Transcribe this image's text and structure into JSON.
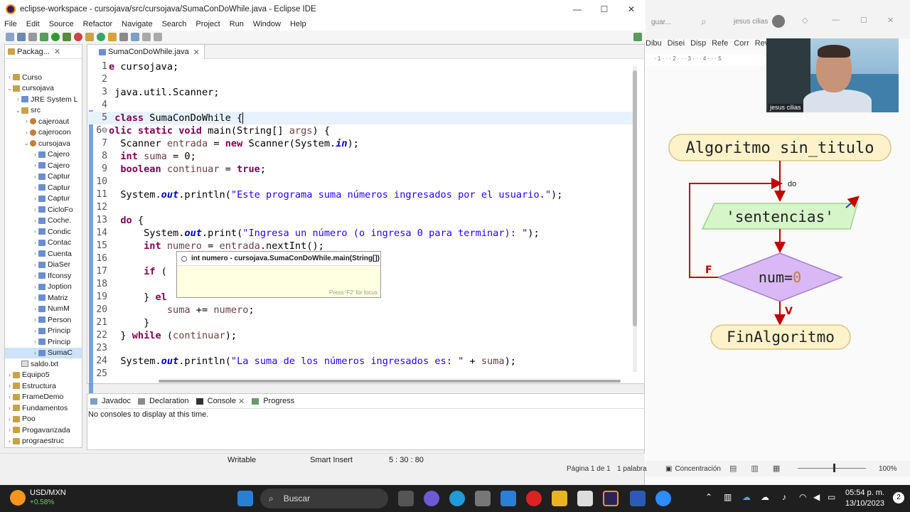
{
  "window": {
    "title": "eclipse-workspace - cursojava/src/cursojava/SumaConDoWhile.java - Eclipse IDE",
    "controls": [
      "—",
      "☐",
      "✕"
    ]
  },
  "menu": [
    "File",
    "Edit",
    "Source",
    "Refactor",
    "Navigate",
    "Search",
    "Project",
    "Run",
    "Window",
    "Help"
  ],
  "package_explorer": {
    "tab_label": "Packag...",
    "items": [
      {
        "label": "Curso",
        "indent": 0,
        "arrow": "›",
        "icon": "proj"
      },
      {
        "label": "cursojava",
        "indent": 0,
        "arrow": "⌄",
        "icon": "proj"
      },
      {
        "label": "JRE System L",
        "indent": 1,
        "arrow": "›",
        "icon": "jicon"
      },
      {
        "label": "src",
        "indent": 1,
        "arrow": "⌄",
        "icon": "proj"
      },
      {
        "label": "cajeroaut",
        "indent": 2,
        "arrow": "›",
        "icon": "pkgicon"
      },
      {
        "label": "cajerocon",
        "indent": 2,
        "arrow": "›",
        "icon": "pkgicon"
      },
      {
        "label": "cursojava",
        "indent": 2,
        "arrow": "⌄",
        "icon": "pkgicon"
      },
      {
        "label": "Cajero",
        "indent": 3,
        "arrow": "›",
        "icon": "jicon"
      },
      {
        "label": "Cajero",
        "indent": 3,
        "arrow": "›",
        "icon": "jicon"
      },
      {
        "label": "Captur",
        "indent": 3,
        "arrow": "›",
        "icon": "jicon"
      },
      {
        "label": "Captur",
        "indent": 3,
        "arrow": "›",
        "icon": "jicon"
      },
      {
        "label": "Captur",
        "indent": 3,
        "arrow": "›",
        "icon": "jicon"
      },
      {
        "label": "CicloFo",
        "indent": 3,
        "arrow": "›",
        "icon": "jicon"
      },
      {
        "label": "Coche.",
        "indent": 3,
        "arrow": "›",
        "icon": "jicon"
      },
      {
        "label": "Condic",
        "indent": 3,
        "arrow": "›",
        "icon": "jicon"
      },
      {
        "label": "Contac",
        "indent": 3,
        "arrow": "›",
        "icon": "jicon"
      },
      {
        "label": "Cuenta",
        "indent": 3,
        "arrow": "›",
        "icon": "jicon"
      },
      {
        "label": "DiaSer",
        "indent": 3,
        "arrow": "›",
        "icon": "jicon"
      },
      {
        "label": "Ifconsy",
        "indent": 3,
        "arrow": "›",
        "icon": "jicon"
      },
      {
        "label": "Joption",
        "indent": 3,
        "arrow": "›",
        "icon": "jicon"
      },
      {
        "label": "Matriz",
        "indent": 3,
        "arrow": "›",
        "icon": "jicon"
      },
      {
        "label": "NumM",
        "indent": 3,
        "arrow": "›",
        "icon": "jicon"
      },
      {
        "label": "Person",
        "indent": 3,
        "arrow": "›",
        "icon": "jicon"
      },
      {
        "label": "Princip",
        "indent": 3,
        "arrow": "›",
        "icon": "jicon"
      },
      {
        "label": "Princip",
        "indent": 3,
        "arrow": "›",
        "icon": "jicon"
      },
      {
        "label": "SumaC",
        "indent": 3,
        "arrow": "›",
        "icon": "jicon",
        "selected": true
      },
      {
        "label": "saldo.txt",
        "indent": 1,
        "arrow": "",
        "icon": "txticon"
      },
      {
        "label": "Equipo5",
        "indent": 0,
        "arrow": "›",
        "icon": "proj"
      },
      {
        "label": "Estructura",
        "indent": 0,
        "arrow": "›",
        "icon": "proj"
      },
      {
        "label": "FrameDemo",
        "indent": 0,
        "arrow": "›",
        "icon": "proj"
      },
      {
        "label": "Fundamentos",
        "indent": 0,
        "arrow": "›",
        "icon": "proj"
      },
      {
        "label": "Poo",
        "indent": 0,
        "arrow": "›",
        "icon": "proj"
      },
      {
        "label": "Progavanzada",
        "indent": 0,
        "arrow": "›",
        "icon": "proj"
      },
      {
        "label": "prograestruc",
        "indent": 0,
        "arrow": "›",
        "icon": "proj"
      }
    ]
  },
  "editor": {
    "tab": "SumaConDoWhile.java",
    "lines": [
      {
        "n": "1",
        "html": "<span class=\"kw\">e</span> cursojava;"
      },
      {
        "n": "2",
        "html": ""
      },
      {
        "n": "3",
        "html": " java.util.Scanner;"
      },
      {
        "n": "4",
        "html": ""
      },
      {
        "n": "5",
        "html": " <span class=\"kw\">class</span> SumaConDoWhile {",
        "current": true
      },
      {
        "n": "6⊖",
        "html": "<span class=\"kw\">olic static void</span> main(String[] <span class=\"var\">args</span>) {"
      },
      {
        "n": "7",
        "html": "  Scanner <span class=\"var\">entrada</span> = <span class=\"kw\">new</span> Scanner(System.<span class=\"fld\">in</span>);"
      },
      {
        "n": "8",
        "html": "  <span class=\"kw\">int</span> <span class=\"var\">suma</span> = 0;"
      },
      {
        "n": "9",
        "html": "  <span class=\"kw\">boolean</span> <span class=\"var\">continuar</span> = <span class=\"kw\">true</span>;"
      },
      {
        "n": "10",
        "html": ""
      },
      {
        "n": "11",
        "html": "  System.<span class=\"fld\">out</span>.println(<span class=\"str\">\"Este programa suma números ingresados por el usuario.\"</span>);"
      },
      {
        "n": "12",
        "html": ""
      },
      {
        "n": "13",
        "html": "  <span class=\"kw\">do</span> {"
      },
      {
        "n": "14",
        "html": "      System.<span class=\"fld\">out</span>.print(<span class=\"str\">\"Ingresa un número (o ingresa 0 para terminar): \"</span>);"
      },
      {
        "n": "15",
        "html": "      <span class=\"kw\">int</span> <span class=\"var\">numero</span> = <span class=\"var\">entrada</span>.nextInt();"
      },
      {
        "n": "16",
        "html": ""
      },
      {
        "n": "17",
        "html": "      <span class=\"kw\">if</span> ("
      },
      {
        "n": "18",
        "html": ""
      },
      {
        "n": "19",
        "html": "      } <span class=\"kw\">el</span>"
      },
      {
        "n": "20",
        "html": "          <span class=\"var\">suma</span> += <span class=\"var\">numero</span>;"
      },
      {
        "n": "21",
        "html": "      }"
      },
      {
        "n": "22",
        "html": "  } <span class=\"kw\">while</span> (<span class=\"var\">continuar</span>);"
      },
      {
        "n": "23",
        "html": ""
      },
      {
        "n": "24",
        "html": "  System.<span class=\"fld\">out</span>.println(<span class=\"str\">\"La suma de los números ingresados es: \"</span> + <span class=\"var\">suma</span>);"
      },
      {
        "n": "25",
        "html": ""
      }
    ],
    "tooltip": {
      "title": "int numero - cursojava.SumaConDoWhile.main(String[])",
      "footer": "Press 'F2' for focus"
    }
  },
  "console": {
    "tabs": [
      "Javadoc",
      "Declaration",
      "Console",
      "Progress"
    ],
    "message": "No consoles to display at this time."
  },
  "status": {
    "writable": "Writable",
    "insert": "Smart Insert",
    "position": "5 : 30 : 80"
  },
  "word": {
    "ribbon": [
      "Dibu",
      "Disei",
      "Disp",
      "Refe",
      "Corr",
      "Revis"
    ],
    "top_text": "guar...",
    "user": "jesus cilias",
    "status": {
      "page": "Página 1 de 1",
      "words": "1 palabra",
      "focus": "Concentración",
      "zoom": "100%"
    }
  },
  "webcam": {
    "name": "jesus cilias"
  },
  "flowchart": {
    "title": "Algoritmo sin_titulo",
    "do_label": "do",
    "sentence": "'sentencias'",
    "condition_left": "num=",
    "condition_right": "0",
    "false_label": "F",
    "true_label": "V",
    "end": "FinAlgoritmo",
    "colors": {
      "start_fill": "#fdf2c9",
      "sentence_fill": "#d6f5c9",
      "cond_fill": "#d9b8f5",
      "arrow": "#c00000"
    }
  },
  "taskbar": {
    "ticker": "USD/MXN",
    "change": "+0.58%",
    "search": "Buscar",
    "time": "05:54 p. m.",
    "date": "13/10/2023",
    "badge": "2"
  }
}
